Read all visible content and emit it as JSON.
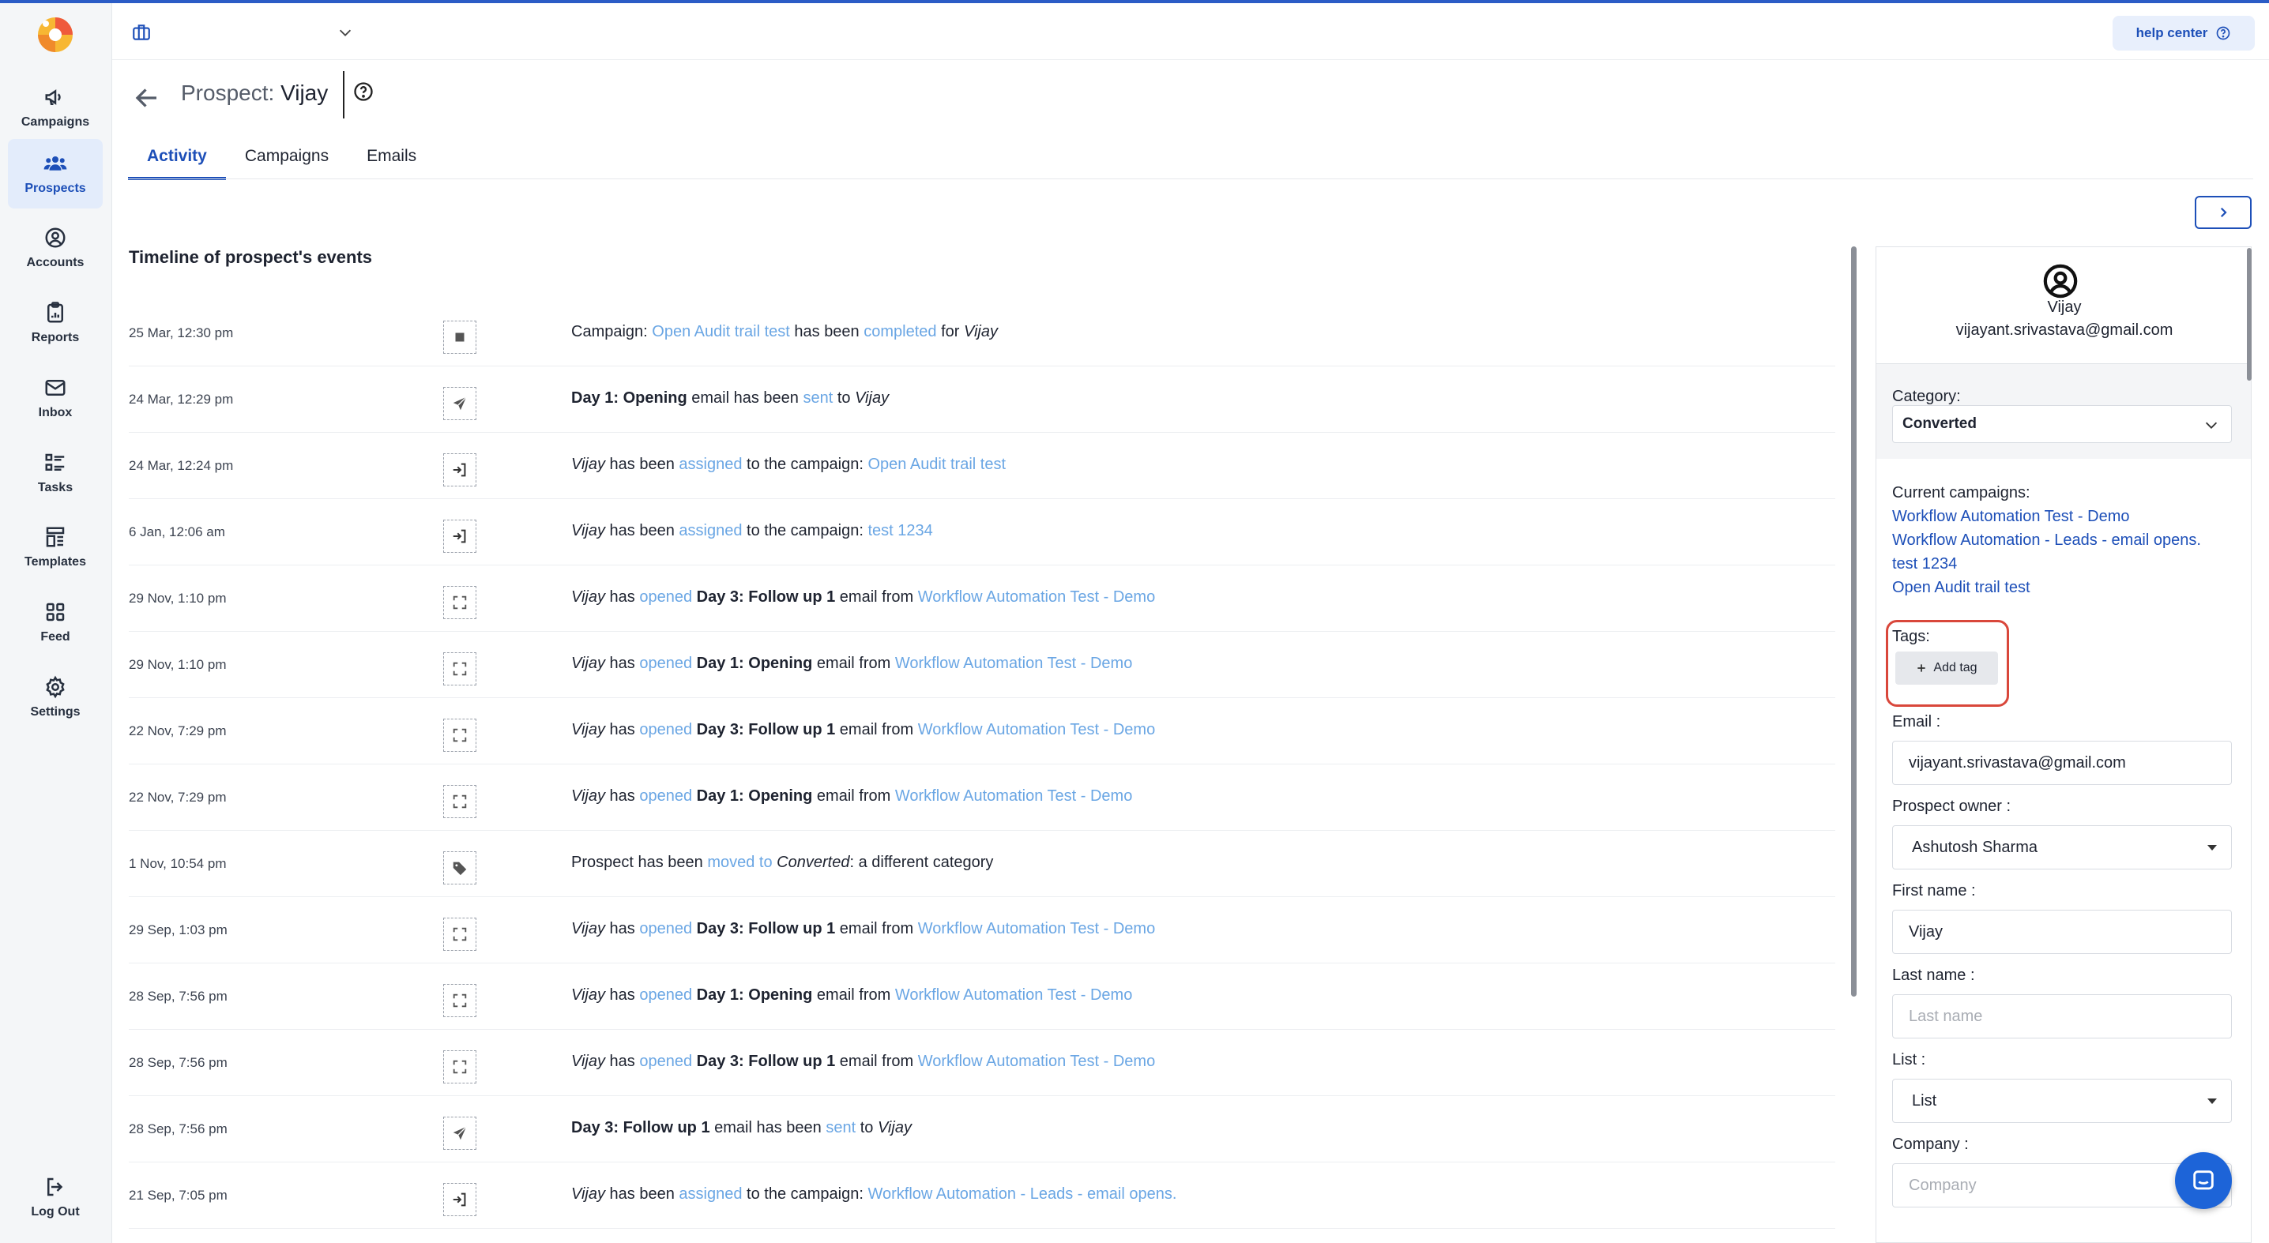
{
  "sidebar": {
    "items": [
      {
        "label": "Campaigns",
        "icon": "megaphone-icon",
        "active": false
      },
      {
        "label": "Prospects",
        "icon": "people-icon",
        "active": true
      },
      {
        "label": "Accounts",
        "icon": "user-circle-icon",
        "active": false
      },
      {
        "label": "Reports",
        "icon": "clipboard-icon",
        "active": false
      },
      {
        "label": "Inbox",
        "icon": "envelope-icon",
        "active": false
      },
      {
        "label": "Tasks",
        "icon": "task-list-icon",
        "active": false
      },
      {
        "label": "Templates",
        "icon": "template-icon",
        "active": false
      },
      {
        "label": "Feed",
        "icon": "grid-icon",
        "active": false
      },
      {
        "label": "Settings",
        "icon": "gear-icon",
        "active": false
      }
    ],
    "logout_label": "Log Out"
  },
  "header": {
    "help_label": "help center"
  },
  "page": {
    "title_prefix": "Prospect:",
    "title_name": "Vijay",
    "tabs": [
      {
        "label": "Activity",
        "active": true
      },
      {
        "label": "Campaigns",
        "active": false
      },
      {
        "label": "Emails",
        "active": false
      }
    ]
  },
  "timeline": {
    "heading": "Timeline of prospect's events",
    "events": [
      {
        "date": "25 Mar, 12:30 pm",
        "icon": "stop-icon",
        "segments": [
          {
            "t": "Campaign: ",
            "s": ""
          },
          {
            "t": "Open Audit trail test",
            "s": "hl"
          },
          {
            "t": " has been ",
            "s": ""
          },
          {
            "t": "completed",
            "s": "hl"
          },
          {
            "t": " for ",
            "s": ""
          },
          {
            "t": "Vijay",
            "s": "i"
          }
        ]
      },
      {
        "date": "24 Mar, 12:29 pm",
        "icon": "send-icon",
        "segments": [
          {
            "t": "Day 1: Opening",
            "s": "b"
          },
          {
            "t": " email has been ",
            "s": ""
          },
          {
            "t": "sent",
            "s": "hl"
          },
          {
            "t": " to ",
            "s": ""
          },
          {
            "t": "Vijay",
            "s": "i"
          }
        ]
      },
      {
        "date": "24 Mar, 12:24 pm",
        "icon": "sign-in-icon",
        "segments": [
          {
            "t": "Vijay",
            "s": "i"
          },
          {
            "t": " has been ",
            "s": ""
          },
          {
            "t": "assigned",
            "s": "hl"
          },
          {
            "t": " to the campaign: ",
            "s": ""
          },
          {
            "t": "Open Audit trail test",
            "s": "hl"
          }
        ]
      },
      {
        "date": "6 Jan, 12:06 am",
        "icon": "sign-in-icon",
        "segments": [
          {
            "t": "Vijay",
            "s": "i"
          },
          {
            "t": " has been ",
            "s": ""
          },
          {
            "t": "assigned",
            "s": "hl"
          },
          {
            "t": " to the campaign: ",
            "s": ""
          },
          {
            "t": "test 1234",
            "s": "hl"
          }
        ]
      },
      {
        "date": "29 Nov, 1:10 pm",
        "icon": "open-icon",
        "segments": [
          {
            "t": "Vijay",
            "s": "i"
          },
          {
            "t": " has ",
            "s": ""
          },
          {
            "t": "opened",
            "s": "hl"
          },
          {
            "t": " ",
            "s": ""
          },
          {
            "t": "Day 3: Follow up 1",
            "s": "b"
          },
          {
            "t": " email from ",
            "s": ""
          },
          {
            "t": "Workflow Automation Test - Demo",
            "s": "hl"
          }
        ]
      },
      {
        "date": "29 Nov, 1:10 pm",
        "icon": "open-icon",
        "segments": [
          {
            "t": "Vijay",
            "s": "i"
          },
          {
            "t": " has ",
            "s": ""
          },
          {
            "t": "opened",
            "s": "hl"
          },
          {
            "t": " ",
            "s": ""
          },
          {
            "t": "Day 1: Opening",
            "s": "b"
          },
          {
            "t": " email from ",
            "s": ""
          },
          {
            "t": "Workflow Automation Test - Demo",
            "s": "hl"
          }
        ]
      },
      {
        "date": "22 Nov, 7:29 pm",
        "icon": "open-icon",
        "segments": [
          {
            "t": "Vijay",
            "s": "i"
          },
          {
            "t": " has ",
            "s": ""
          },
          {
            "t": "opened",
            "s": "hl"
          },
          {
            "t": " ",
            "s": ""
          },
          {
            "t": "Day 3: Follow up 1",
            "s": "b"
          },
          {
            "t": " email from ",
            "s": ""
          },
          {
            "t": "Workflow Automation Test - Demo",
            "s": "hl"
          }
        ]
      },
      {
        "date": "22 Nov, 7:29 pm",
        "icon": "open-icon",
        "segments": [
          {
            "t": "Vijay",
            "s": "i"
          },
          {
            "t": " has ",
            "s": ""
          },
          {
            "t": "opened",
            "s": "hl"
          },
          {
            "t": " ",
            "s": ""
          },
          {
            "t": "Day 1: Opening",
            "s": "b"
          },
          {
            "t": " email from ",
            "s": ""
          },
          {
            "t": "Workflow Automation Test - Demo",
            "s": "hl"
          }
        ]
      },
      {
        "date": "1 Nov, 10:54 pm",
        "icon": "tag-icon",
        "segments": [
          {
            "t": "Prospect has been ",
            "s": ""
          },
          {
            "t": "moved to",
            "s": "hl"
          },
          {
            "t": " ",
            "s": ""
          },
          {
            "t": "Converted",
            "s": "i"
          },
          {
            "t": ": a different category",
            "s": ""
          }
        ]
      },
      {
        "date": "29 Sep, 1:03 pm",
        "icon": "open-icon",
        "segments": [
          {
            "t": "Vijay",
            "s": "i"
          },
          {
            "t": " has ",
            "s": ""
          },
          {
            "t": "opened",
            "s": "hl"
          },
          {
            "t": " ",
            "s": ""
          },
          {
            "t": "Day 3: Follow up 1",
            "s": "b"
          },
          {
            "t": " email from ",
            "s": ""
          },
          {
            "t": "Workflow Automation Test - Demo",
            "s": "hl"
          }
        ]
      },
      {
        "date": "28 Sep, 7:56 pm",
        "icon": "open-icon",
        "segments": [
          {
            "t": "Vijay",
            "s": "i"
          },
          {
            "t": " has ",
            "s": ""
          },
          {
            "t": "opened",
            "s": "hl"
          },
          {
            "t": " ",
            "s": ""
          },
          {
            "t": "Day 1: Opening",
            "s": "b"
          },
          {
            "t": " email from ",
            "s": ""
          },
          {
            "t": "Workflow Automation Test - Demo",
            "s": "hl"
          }
        ]
      },
      {
        "date": "28 Sep, 7:56 pm",
        "icon": "open-icon",
        "segments": [
          {
            "t": "Vijay",
            "s": "i"
          },
          {
            "t": " has ",
            "s": ""
          },
          {
            "t": "opened",
            "s": "hl"
          },
          {
            "t": " ",
            "s": ""
          },
          {
            "t": "Day 3: Follow up 1",
            "s": "b"
          },
          {
            "t": " email from ",
            "s": ""
          },
          {
            "t": "Workflow Automation Test - Demo",
            "s": "hl"
          }
        ]
      },
      {
        "date": "28 Sep, 7:56 pm",
        "icon": "send-icon",
        "segments": [
          {
            "t": "Day 3: Follow up 1",
            "s": "b"
          },
          {
            "t": " email has been ",
            "s": ""
          },
          {
            "t": "sent",
            "s": "hl"
          },
          {
            "t": " to ",
            "s": ""
          },
          {
            "t": "Vijay",
            "s": "i"
          }
        ]
      },
      {
        "date": "21 Sep, 7:05 pm",
        "icon": "sign-in-icon",
        "segments": [
          {
            "t": "Vijay",
            "s": "i"
          },
          {
            "t": " has been ",
            "s": ""
          },
          {
            "t": "assigned",
            "s": "hl"
          },
          {
            "t": " to the campaign: ",
            "s": ""
          },
          {
            "t": "Workflow Automation - Leads - email opens.",
            "s": "hl"
          }
        ]
      }
    ]
  },
  "prospect": {
    "name": "Vijay",
    "email": "vijayant.srivastava@gmail.com",
    "category_label": "Category:",
    "category_value": "Converted",
    "current_campaigns_label": "Current campaigns:",
    "campaigns": [
      "Workflow Automation Test - Demo",
      "Workflow Automation - Leads - email opens.",
      "test 1234",
      "Open Audit trail test"
    ],
    "tags_label": "Tags:",
    "add_tag_label": "Add tag",
    "email_label": "Email :",
    "email_value": "vijayant.srivastava@gmail.com",
    "owner_label": "Prospect owner :",
    "owner_value": "Ashutosh Sharma",
    "first_name_label": "First name :",
    "first_name_value": "Vijay",
    "last_name_label": "Last name :",
    "last_name_placeholder": "Last name",
    "list_label": "List :",
    "list_value": "List",
    "company_label": "Company :",
    "company_placeholder": "Company"
  },
  "colors": {
    "accent": "#1d4fb8",
    "highlight": "#6aa6e4",
    "annotation": "#d9473b",
    "chat_button": "#1d64d8"
  }
}
